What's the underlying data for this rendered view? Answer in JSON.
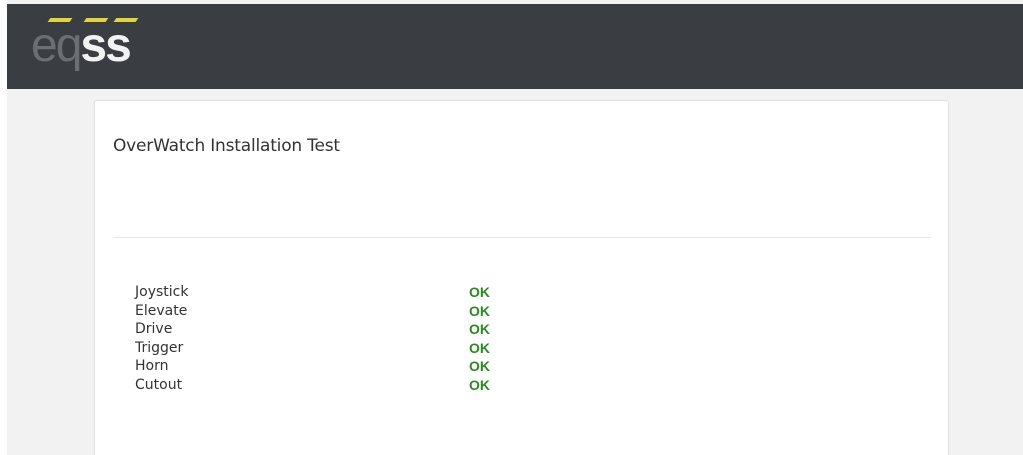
{
  "header": {
    "logo": {
      "text_eq": "eq",
      "text_ss": "ss",
      "accent_color": "#e3d43a"
    },
    "background_color": "#3a3d42"
  },
  "card": {
    "title": "OverWatch Installation Test",
    "results": [
      {
        "label": "Joystick",
        "status": "OK"
      },
      {
        "label": "Elevate",
        "status": "OK"
      },
      {
        "label": "Drive",
        "status": "OK"
      },
      {
        "label": "Trigger",
        "status": "OK"
      },
      {
        "label": "Horn",
        "status": "OK"
      },
      {
        "label": "Cutout",
        "status": "OK"
      }
    ],
    "status_color": "#2a8a1f"
  }
}
